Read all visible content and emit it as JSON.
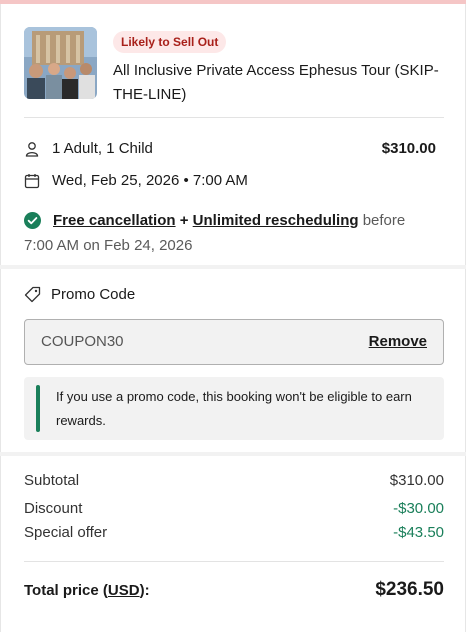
{
  "product": {
    "badge": "Likely to Sell Out",
    "title": "All Inclusive Private Access Ephesus Tour (SKIP-THE-LINE)"
  },
  "booking": {
    "travelers": "1 Adult, 1 Child",
    "price": "$310.00",
    "datetime": "Wed, Feb 25, 2026 • 7:00 AM"
  },
  "cancellation": {
    "free_cancellation": "Free cancellation",
    "plus": "+",
    "unlimited_rescheduling": "Unlimited rescheduling",
    "before": "before",
    "deadline": "7:00 AM on Feb 24, 2026"
  },
  "promo": {
    "label": "Promo Code",
    "code": "COUPON30",
    "remove_label": "Remove",
    "notice": "If you use a promo code, this booking won't be eligible to earn rewards."
  },
  "summary": {
    "subtotal_label": "Subtotal",
    "subtotal_value": "$310.00",
    "discount_label": "Discount",
    "discount_value": "-$30.00",
    "special_label": "Special offer",
    "special_value": "-$43.50",
    "total_label_prefix": "Total price (",
    "total_currency": "USD",
    "total_label_suffix": "):",
    "total_value": "$236.50"
  },
  "colors": {
    "accent_green": "#1a7f5a",
    "badge_bg": "#fde8e8",
    "badge_text": "#a8201a"
  }
}
